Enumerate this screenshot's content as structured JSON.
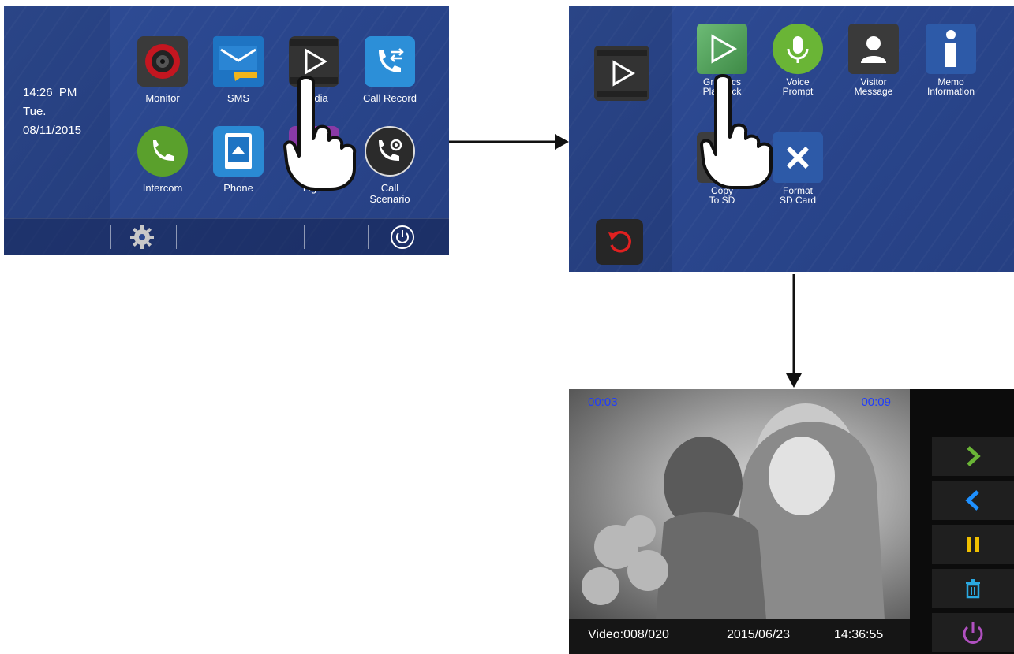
{
  "screen1": {
    "time": "14:26  PM",
    "day": "Tue.",
    "date": "08/11/2015",
    "apps": [
      {
        "label": "Monitor",
        "icon": "camera-icon",
        "color": "#3a3a3a"
      },
      {
        "label": "SMS",
        "icon": "envelope-icon",
        "color": "#1e74c3"
      },
      {
        "label": "Media",
        "icon": "play-film-icon",
        "color": "#333333"
      },
      {
        "label": "Call Record",
        "icon": "call-transfer-icon",
        "color": "#2c8fd8"
      },
      {
        "label": "Intercom",
        "icon": "phone-handset-icon",
        "color": "#5aa02c"
      },
      {
        "label": "Phone",
        "icon": "tablet-icon",
        "color": "#2a8ad4"
      },
      {
        "label": "Light",
        "icon": "light-icon",
        "color": "#8a3aa6"
      },
      {
        "label": "Call\nScenario",
        "icon": "phone-gear-icon",
        "color": "#2b2b2b"
      }
    ],
    "bottom": {
      "settings_icon": "gear-icon",
      "power_icon": "power-icon"
    }
  },
  "screen2": {
    "header_icon": "play-film-icon",
    "apps": [
      {
        "label": "Graphics\nPlayback",
        "icon": "play-icon",
        "color": "#4f9a55"
      },
      {
        "label": "Voice\nPrompt",
        "icon": "microphone-icon",
        "color": "#6ab536"
      },
      {
        "label": "Visitor\nMessage",
        "icon": "person-icon",
        "color": "#3a3a3a"
      },
      {
        "label": "Memo\nInformation",
        "icon": "info-icon",
        "color": "#2d5aa8"
      },
      {
        "label": "Copy\nTo SD",
        "icon": "copy-icon",
        "color": "#3d3d3d"
      },
      {
        "label": "Format\nSD Card",
        "icon": "close-icon",
        "color": "#2d5aa8"
      }
    ],
    "back_icon": "back-icon"
  },
  "screen3": {
    "elapsed": "00:03",
    "total": "00:09",
    "video_counter": "Video:008/020",
    "date": "2015/06/23",
    "time": "14:36:55",
    "controls": [
      {
        "name": "next-icon",
        "color": "#6ab536"
      },
      {
        "name": "previous-icon",
        "color": "#1e90ff"
      },
      {
        "name": "pause-icon",
        "color": "#f0c000"
      },
      {
        "name": "delete-icon",
        "color": "#2aa8e0"
      },
      {
        "name": "power-icon",
        "color": "#b050c0"
      }
    ]
  },
  "colors": {
    "screen_bg": "#2b4890",
    "time_text": "#1e3cff"
  }
}
